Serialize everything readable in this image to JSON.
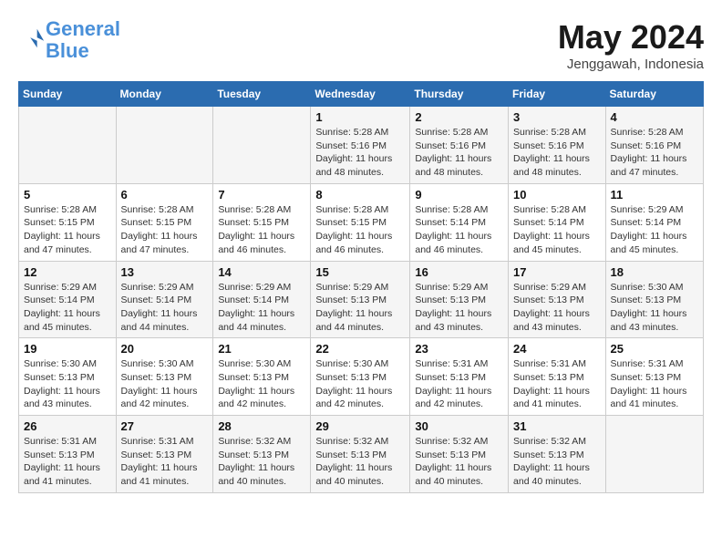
{
  "logo": {
    "line1": "General",
    "line2": "Blue"
  },
  "title": "May 2024",
  "location": "Jenggawah, Indonesia",
  "days_of_week": [
    "Sunday",
    "Monday",
    "Tuesday",
    "Wednesday",
    "Thursday",
    "Friday",
    "Saturday"
  ],
  "weeks": [
    [
      {
        "day": "",
        "info": ""
      },
      {
        "day": "",
        "info": ""
      },
      {
        "day": "",
        "info": ""
      },
      {
        "day": "1",
        "info": "Sunrise: 5:28 AM\nSunset: 5:16 PM\nDaylight: 11 hours\nand 48 minutes."
      },
      {
        "day": "2",
        "info": "Sunrise: 5:28 AM\nSunset: 5:16 PM\nDaylight: 11 hours\nand 48 minutes."
      },
      {
        "day": "3",
        "info": "Sunrise: 5:28 AM\nSunset: 5:16 PM\nDaylight: 11 hours\nand 48 minutes."
      },
      {
        "day": "4",
        "info": "Sunrise: 5:28 AM\nSunset: 5:16 PM\nDaylight: 11 hours\nand 47 minutes."
      }
    ],
    [
      {
        "day": "5",
        "info": "Sunrise: 5:28 AM\nSunset: 5:15 PM\nDaylight: 11 hours\nand 47 minutes."
      },
      {
        "day": "6",
        "info": "Sunrise: 5:28 AM\nSunset: 5:15 PM\nDaylight: 11 hours\nand 47 minutes."
      },
      {
        "day": "7",
        "info": "Sunrise: 5:28 AM\nSunset: 5:15 PM\nDaylight: 11 hours\nand 46 minutes."
      },
      {
        "day": "8",
        "info": "Sunrise: 5:28 AM\nSunset: 5:15 PM\nDaylight: 11 hours\nand 46 minutes."
      },
      {
        "day": "9",
        "info": "Sunrise: 5:28 AM\nSunset: 5:14 PM\nDaylight: 11 hours\nand 46 minutes."
      },
      {
        "day": "10",
        "info": "Sunrise: 5:28 AM\nSunset: 5:14 PM\nDaylight: 11 hours\nand 45 minutes."
      },
      {
        "day": "11",
        "info": "Sunrise: 5:29 AM\nSunset: 5:14 PM\nDaylight: 11 hours\nand 45 minutes."
      }
    ],
    [
      {
        "day": "12",
        "info": "Sunrise: 5:29 AM\nSunset: 5:14 PM\nDaylight: 11 hours\nand 45 minutes."
      },
      {
        "day": "13",
        "info": "Sunrise: 5:29 AM\nSunset: 5:14 PM\nDaylight: 11 hours\nand 44 minutes."
      },
      {
        "day": "14",
        "info": "Sunrise: 5:29 AM\nSunset: 5:14 PM\nDaylight: 11 hours\nand 44 minutes."
      },
      {
        "day": "15",
        "info": "Sunrise: 5:29 AM\nSunset: 5:13 PM\nDaylight: 11 hours\nand 44 minutes."
      },
      {
        "day": "16",
        "info": "Sunrise: 5:29 AM\nSunset: 5:13 PM\nDaylight: 11 hours\nand 43 minutes."
      },
      {
        "day": "17",
        "info": "Sunrise: 5:29 AM\nSunset: 5:13 PM\nDaylight: 11 hours\nand 43 minutes."
      },
      {
        "day": "18",
        "info": "Sunrise: 5:30 AM\nSunset: 5:13 PM\nDaylight: 11 hours\nand 43 minutes."
      }
    ],
    [
      {
        "day": "19",
        "info": "Sunrise: 5:30 AM\nSunset: 5:13 PM\nDaylight: 11 hours\nand 43 minutes."
      },
      {
        "day": "20",
        "info": "Sunrise: 5:30 AM\nSunset: 5:13 PM\nDaylight: 11 hours\nand 42 minutes."
      },
      {
        "day": "21",
        "info": "Sunrise: 5:30 AM\nSunset: 5:13 PM\nDaylight: 11 hours\nand 42 minutes."
      },
      {
        "day": "22",
        "info": "Sunrise: 5:30 AM\nSunset: 5:13 PM\nDaylight: 11 hours\nand 42 minutes."
      },
      {
        "day": "23",
        "info": "Sunrise: 5:31 AM\nSunset: 5:13 PM\nDaylight: 11 hours\nand 42 minutes."
      },
      {
        "day": "24",
        "info": "Sunrise: 5:31 AM\nSunset: 5:13 PM\nDaylight: 11 hours\nand 41 minutes."
      },
      {
        "day": "25",
        "info": "Sunrise: 5:31 AM\nSunset: 5:13 PM\nDaylight: 11 hours\nand 41 minutes."
      }
    ],
    [
      {
        "day": "26",
        "info": "Sunrise: 5:31 AM\nSunset: 5:13 PM\nDaylight: 11 hours\nand 41 minutes."
      },
      {
        "day": "27",
        "info": "Sunrise: 5:31 AM\nSunset: 5:13 PM\nDaylight: 11 hours\nand 41 minutes."
      },
      {
        "day": "28",
        "info": "Sunrise: 5:32 AM\nSunset: 5:13 PM\nDaylight: 11 hours\nand 40 minutes."
      },
      {
        "day": "29",
        "info": "Sunrise: 5:32 AM\nSunset: 5:13 PM\nDaylight: 11 hours\nand 40 minutes."
      },
      {
        "day": "30",
        "info": "Sunrise: 5:32 AM\nSunset: 5:13 PM\nDaylight: 11 hours\nand 40 minutes."
      },
      {
        "day": "31",
        "info": "Sunrise: 5:32 AM\nSunset: 5:13 PM\nDaylight: 11 hours\nand 40 minutes."
      },
      {
        "day": "",
        "info": ""
      }
    ]
  ]
}
